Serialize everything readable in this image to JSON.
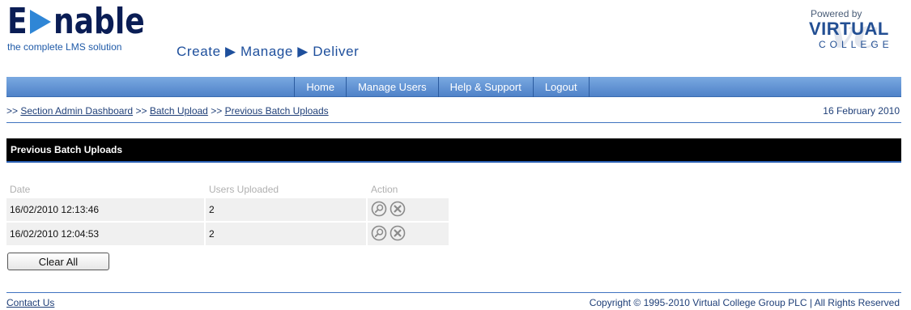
{
  "header": {
    "logo_brand": "Enable",
    "logo_tagline": "the complete LMS solution",
    "slogan": "Create ▶ Manage ▶ Deliver",
    "powered_by": "Powered by",
    "powered_name": "VIRTUAL",
    "powered_sub": "COLLEGE"
  },
  "nav": {
    "items": [
      {
        "label": "Home"
      },
      {
        "label": "Manage Users"
      },
      {
        "label": "Help & Support"
      },
      {
        "label": "Logout"
      }
    ]
  },
  "breadcrumb": {
    "prefix": ">>",
    "items": [
      {
        "label": "Section Admin Dashboard"
      },
      {
        "label": "Batch Upload"
      },
      {
        "label": "Previous Batch Uploads"
      }
    ],
    "date": "16 February 2010"
  },
  "section": {
    "title": "Previous Batch Uploads"
  },
  "table": {
    "columns": [
      "Date",
      "Users Uploaded",
      "Action"
    ],
    "rows": [
      {
        "date": "16/02/2010 12:13:46",
        "users": "2",
        "actions": [
          "view-icon",
          "delete-icon"
        ]
      },
      {
        "date": "16/02/2010 12:04:53",
        "users": "2",
        "actions": [
          "view-icon",
          "delete-icon"
        ]
      }
    ]
  },
  "buttons": {
    "clear_all": "Clear All"
  },
  "footer": {
    "contact": "Contact Us",
    "copyright": "Copyright © 1995-2010 Virtual College Group PLC | All Rights Reserved"
  },
  "colors": {
    "nav_top": "#7aa9e1",
    "nav_bottom": "#4f82c8",
    "logo_dark": "#0a1d55",
    "logo_accent": "#2f86d6",
    "link": "#1f3f78",
    "section_bar": "#000000",
    "rule": "#3f73c0"
  }
}
